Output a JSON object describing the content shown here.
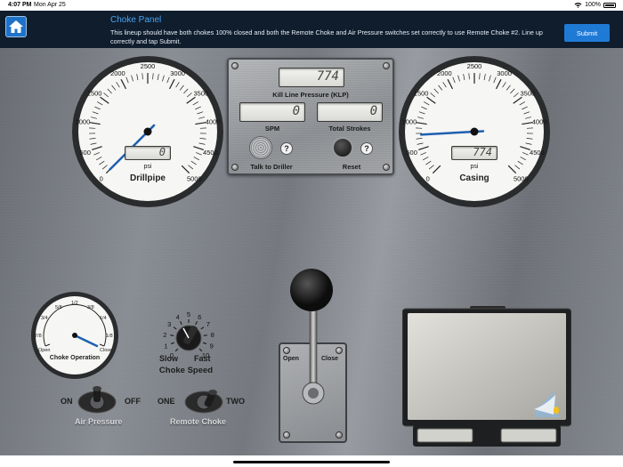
{
  "status": {
    "time": "4:07 PM",
    "date": "Mon Apr 25",
    "battery": "100%"
  },
  "header": {
    "title": "Choke Panel",
    "message": "This lineup should have both chokes 100% closed and both the Remote Choke and Air Pressure switches set correctly to use Remote Choke #2. Line up correctly and tap Submit.",
    "submit_label": "Submit"
  },
  "drillpipe_gauge": {
    "name": "Drillpipe",
    "unit": "psi",
    "readout": "0",
    "value": 0,
    "ticks": [
      "0",
      "500",
      "1000",
      "1500",
      "2000",
      "2500",
      "3000",
      "3500",
      "4000",
      "4500",
      "5000"
    ]
  },
  "casing_gauge": {
    "name": "Casing",
    "unit": "psi",
    "readout": "774",
    "value": 774,
    "ticks": [
      "0",
      "500",
      "1000",
      "1500",
      "2000",
      "2500",
      "3000",
      "3500",
      "4000",
      "4500",
      "5000"
    ]
  },
  "center_panel": {
    "klp_label": "Kill Line Pressure (KLP)",
    "klp_value": "774",
    "spm_label": "SPM",
    "spm_value": "0",
    "strokes_label": "Total Strokes",
    "strokes_value": "0",
    "talk_label": "Talk to Driller",
    "reset_label": "Reset",
    "help_glyph": "?"
  },
  "choke_operation": {
    "label": "Choke Operation",
    "open_label": "Open",
    "close_label": "Close",
    "ticks": [
      "7/8",
      "3/4",
      "5/8",
      "1/2",
      "3/8",
      "1/4",
      "1/8"
    ]
  },
  "choke_speed": {
    "label": "Choke Speed",
    "slow_label": "Slow",
    "fast_label": "Fast",
    "ticks": [
      "0",
      "1",
      "2",
      "3",
      "4",
      "5",
      "6",
      "7",
      "8",
      "9",
      "10"
    ]
  },
  "air_pressure": {
    "label": "Air Pressure",
    "on_label": "ON",
    "off_label": "OFF"
  },
  "remote_choke": {
    "label": "Remote Choke",
    "one_label": "ONE",
    "two_label": "TWO"
  },
  "lever": {
    "open_label": "Open",
    "close_label": "Close"
  },
  "icons": {
    "home": "home-icon",
    "talk": "speaker-grille-icon",
    "lightbulb": "lightbulb-icon"
  },
  "colors": {
    "accent": "#1f7ad6",
    "header_bg": "#0f1d2d",
    "needle": "#1e5fb0"
  }
}
